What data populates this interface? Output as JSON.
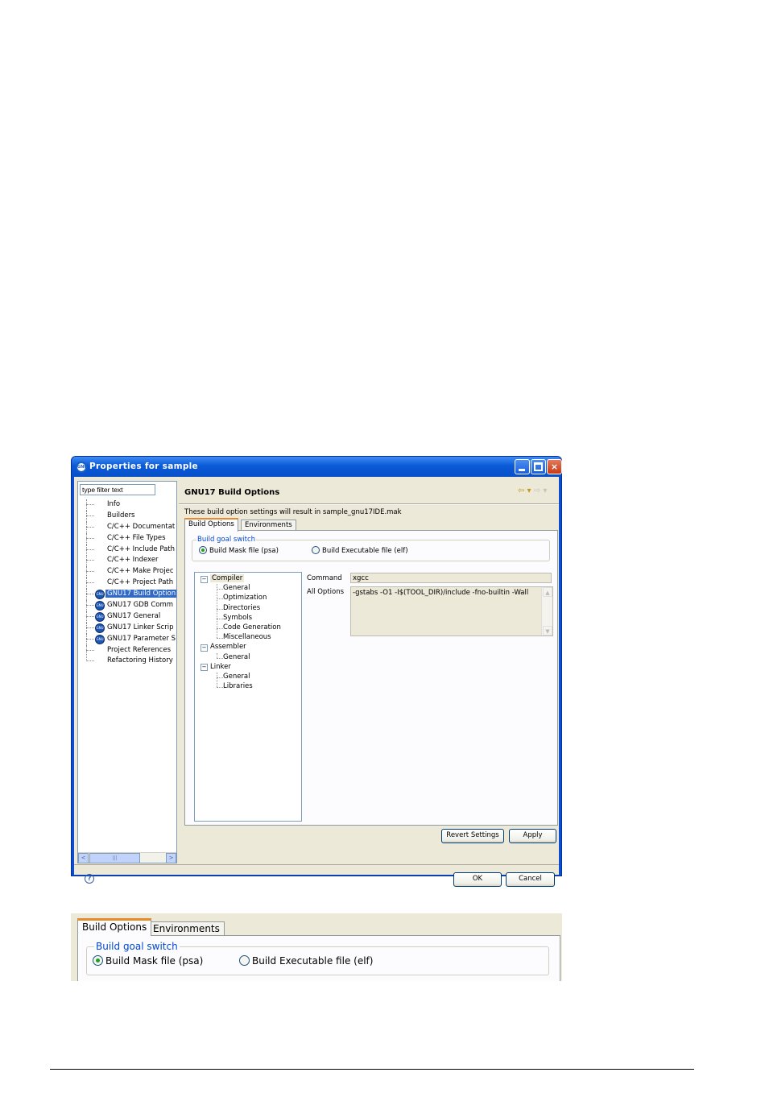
{
  "window": {
    "title": "Properties for sample",
    "minimize_glyph": "",
    "maximize_glyph": "",
    "close_glyph": "×"
  },
  "sidebar": {
    "filter_placeholder": "type filter text",
    "items": [
      {
        "label": "Info",
        "icon": "none"
      },
      {
        "label": "Builders",
        "icon": "none"
      },
      {
        "label": "C/C++ Documentat",
        "icon": "none"
      },
      {
        "label": "C/C++ File Types",
        "icon": "none"
      },
      {
        "label": "C/C++ Include Path",
        "icon": "none"
      },
      {
        "label": "C/C++ Indexer",
        "icon": "none"
      },
      {
        "label": "C/C++ Make Projec",
        "icon": "none"
      },
      {
        "label": "C/C++ Project Path",
        "icon": "none"
      },
      {
        "label": "GNU17 Build Option",
        "icon": "gnu-icon",
        "selected": true
      },
      {
        "label": "GNU17 GDB Comm",
        "icon": "gnu-icon"
      },
      {
        "label": "GNU17 General",
        "icon": "gnu-icon"
      },
      {
        "label": "GNU17 Linker Scrip",
        "icon": "gnu-icon"
      },
      {
        "label": "GNU17 Parameter S",
        "icon": "gnu-icon"
      },
      {
        "label": "Project References",
        "icon": "none"
      },
      {
        "label": "Refactoring History",
        "icon": "none"
      }
    ],
    "scroll_left": "<",
    "scroll_thumb": "|||",
    "scroll_right": ">"
  },
  "page": {
    "title": "GNU17 Build Options",
    "back_arrow": "⇦ ▾",
    "forward_arrow": "⇨ ▾",
    "info": "These build option settings will result in sample_gnu17IDE.mak",
    "tabs": [
      {
        "label": "Build Options",
        "active": true
      },
      {
        "label": "Environments",
        "active": false
      }
    ],
    "group_title": "Build goal switch",
    "radio_mask": "Build Mask file (psa)",
    "radio_exec": "Build Executable file (elf)",
    "selected_radio": "mask",
    "tree": [
      {
        "label": "Compiler",
        "level": 0,
        "expanded": true,
        "selected": true
      },
      {
        "label": "General",
        "level": 1
      },
      {
        "label": "Optimization",
        "level": 1
      },
      {
        "label": "Directories",
        "level": 1
      },
      {
        "label": "Symbols",
        "level": 1
      },
      {
        "label": "Code Generation",
        "level": 1
      },
      {
        "label": "Miscellaneous",
        "level": 1
      },
      {
        "label": "Assembler",
        "level": 0,
        "expanded": true
      },
      {
        "label": "General",
        "level": 1
      },
      {
        "label": "Linker",
        "level": 0,
        "expanded": true
      },
      {
        "label": "General",
        "level": 1
      },
      {
        "label": "Libraries",
        "level": 1
      }
    ],
    "command_label": "Command",
    "command_value": "xgcc",
    "all_options_label": "All Options",
    "all_options_value": "-gstabs -O1 -I$(TOOL_DIR)/include -fno-builtin -Wall",
    "revert_label": "Revert Settings",
    "apply_label": "Apply"
  },
  "footer": {
    "help_glyph": "?",
    "ok_label": "OK",
    "cancel_label": "Cancel"
  },
  "zoom": {
    "tabs": [
      {
        "label": "Build Options",
        "active": true
      },
      {
        "label": "Environments",
        "active": false
      }
    ],
    "group_title": "Build goal switch",
    "radio_mask": "Build Mask file (psa)",
    "radio_exec": "Build Executable file (elf)"
  }
}
